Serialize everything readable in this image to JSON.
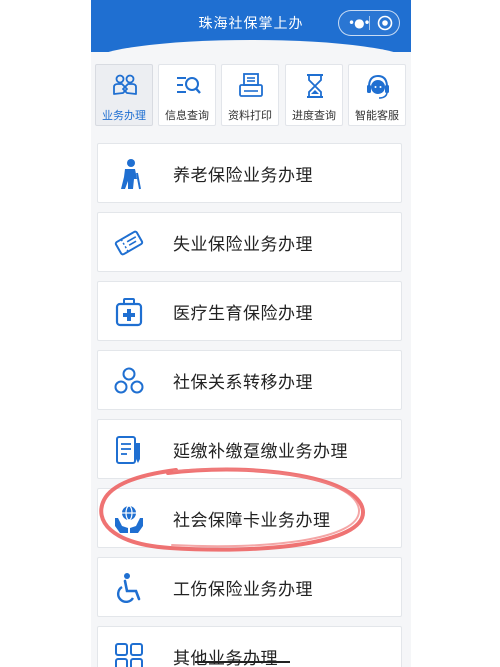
{
  "header": {
    "title": "珠海社保掌上办",
    "more_glyph": "•●•",
    "accent_color": "#1f6fd1"
  },
  "tabs": [
    {
      "label": "业务办理",
      "icon": "handshake-icon",
      "active": true
    },
    {
      "label": "信息查询",
      "icon": "search-list-icon",
      "active": false
    },
    {
      "label": "资料打印",
      "icon": "printer-icon",
      "active": false
    },
    {
      "label": "进度查询",
      "icon": "hourglass-icon",
      "active": false
    },
    {
      "label": "智能客服",
      "icon": "headset-icon",
      "active": false
    }
  ],
  "services": [
    {
      "label": "养老保险业务办理",
      "icon": "elderly-person-icon"
    },
    {
      "label": "失业保险业务办理",
      "icon": "ticket-icon"
    },
    {
      "label": "医疗生育保险办理",
      "icon": "medical-kit-icon"
    },
    {
      "label": "社保关系转移办理",
      "icon": "network-icon"
    },
    {
      "label": "延缴补缴趸缴业务办理",
      "icon": "document-pen-icon"
    },
    {
      "label": "社会保障卡业务办理",
      "icon": "globe-hands-icon"
    },
    {
      "label": "工伤保险业务办理",
      "icon": "wheelchair-icon"
    },
    {
      "label": "其他业务办理",
      "icon": "grid-apps-icon"
    }
  ]
}
